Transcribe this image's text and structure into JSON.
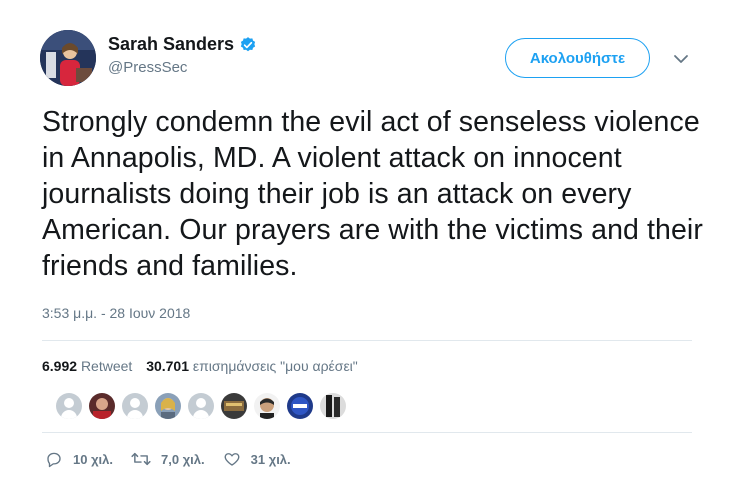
{
  "user": {
    "display_name": "Sarah Sanders",
    "handle": "@PressSec",
    "verified_icon": "verified-badge-icon"
  },
  "follow_button": {
    "label": "Ακολουθήστε"
  },
  "tweet": {
    "text": "Strongly condemn the evil act of senseless violence in Annapolis, MD. A violent attack on innocent journalists doing their job is an attack on every American. Our prayers are with the victims and their friends and families.",
    "timestamp": "3:53 μ.μ. - 28 Ιουν 2018"
  },
  "stats": {
    "retweets_count": "6.992",
    "retweets_label": "Retweet",
    "likes_count": "30.701",
    "likes_label": "επισημάνσεις \"μου αρέσει\""
  },
  "actions": {
    "reply_count": "10 χιλ.",
    "retweet_count": "7,0 χιλ.",
    "like_count": "31 χιλ."
  },
  "colors": {
    "accent": "#1da1f2",
    "muted": "#657786",
    "text": "#14171a",
    "divider": "#e1e8ed"
  }
}
